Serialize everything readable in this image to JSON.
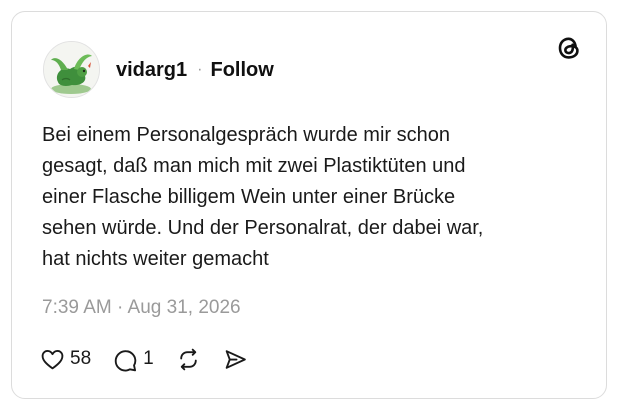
{
  "post": {
    "author": {
      "username": "vidarg1",
      "avatar_icon": "dragon-avatar-icon"
    },
    "separator": "·",
    "follow_label": "Follow",
    "brand_icon": "threads-logo-icon",
    "text": "Bei einem Personalgespräch wurde mir schon\ngesagt, daß man mich mit zwei Plastiktüten und\neiner Flasche billigem Wein unter einer Brücke\nsehen würde. Und der Personalrat, der dabei war,\nhat nichts weiter gemacht",
    "timestamp": "7:39 AM · Aug 31, 2026",
    "actions": {
      "like_icon": "heart-icon",
      "like_count": "58",
      "reply_icon": "comment-bubble-icon",
      "reply_count": "1",
      "repost_icon": "repost-icon",
      "share_icon": "send-icon"
    }
  },
  "colors": {
    "text": "#101010",
    "muted": "#9a9a9a",
    "border": "#dcdcdc",
    "background": "#ffffff"
  }
}
